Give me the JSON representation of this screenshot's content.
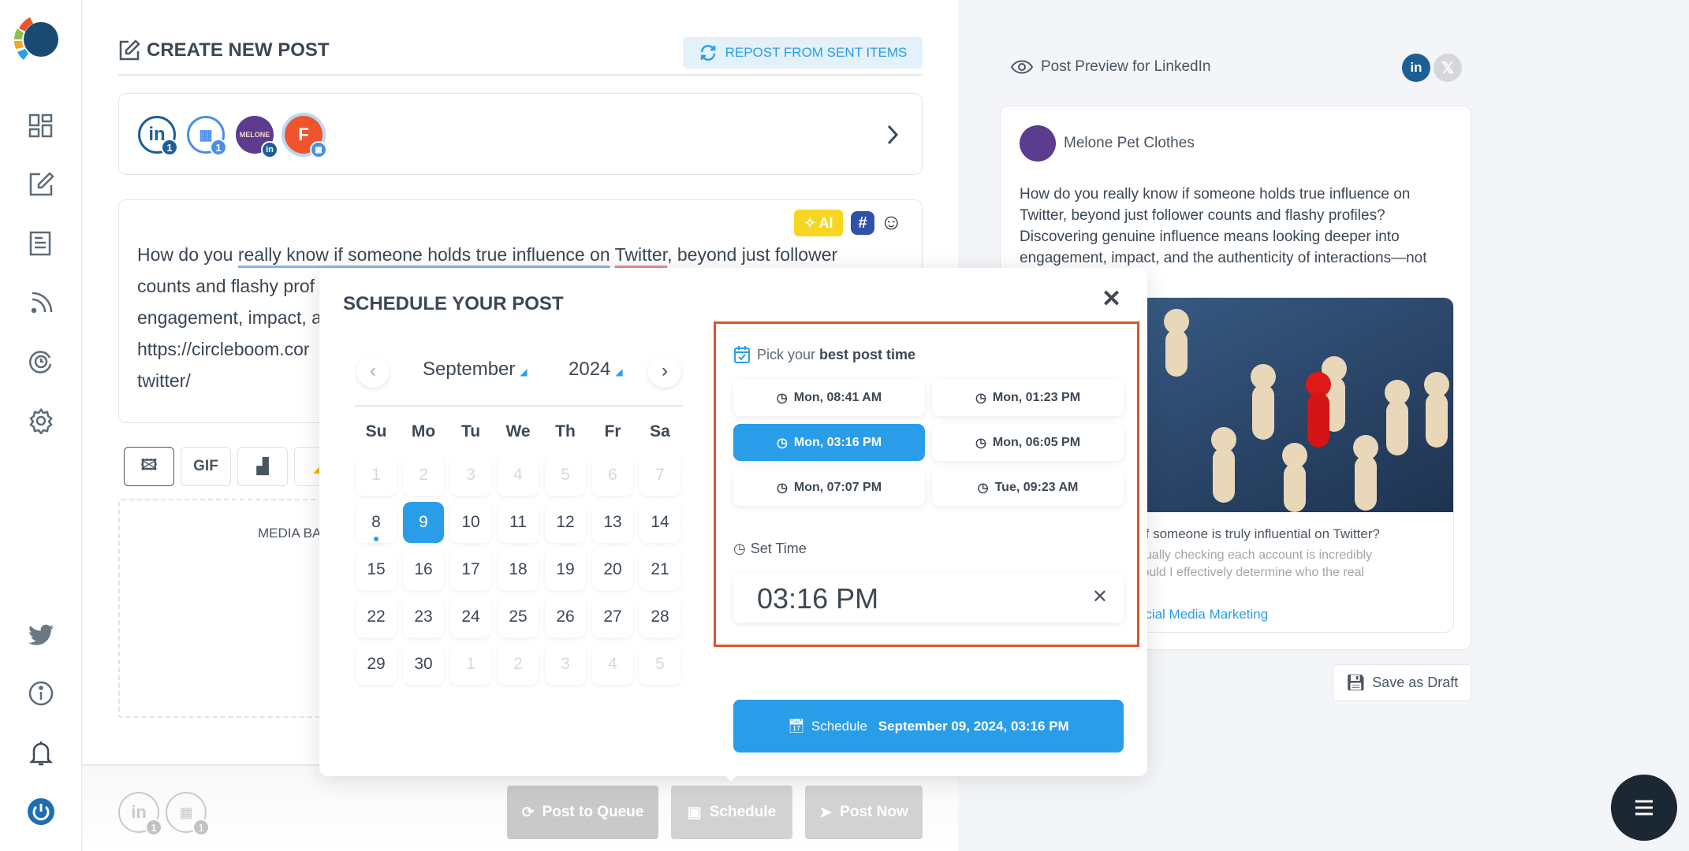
{
  "sidebar": {
    "items": [
      "dashboard",
      "compose",
      "articles",
      "rss",
      "queue",
      "settings",
      "twitter",
      "info",
      "notifications",
      "power"
    ]
  },
  "header": {
    "title": "CREATE NEW POST",
    "repost_label": "REPOST FROM SENT ITEMS"
  },
  "accounts": [
    {
      "type": "linkedin",
      "count": "1"
    },
    {
      "type": "google-business",
      "count": "1"
    },
    {
      "type": "melone-linkedin",
      "label": "MELONE"
    },
    {
      "type": "facebook",
      "label": "F"
    }
  ],
  "composer": {
    "ai_label": "AI",
    "text_a": "How do you ",
    "text_u1": "really know if someone holds true influence on",
    "text_b": " ",
    "text_u2": "Twitter",
    "text_c": ", beyond just follower",
    "line2": "counts and flashy prof",
    "line3": "engagement, impact, a",
    "line4": "https://circleboom.cor",
    "line5": "twitter/"
  },
  "media": {
    "gif_label": "GIF",
    "dropzone_label": "MEDIA BA"
  },
  "footer": {
    "post_queue": "Post to Queue",
    "schedule": "Schedule",
    "post_now": "Post Now",
    "accounts": [
      {
        "type": "linkedin",
        "count": "1"
      },
      {
        "type": "google-business",
        "count": "1"
      }
    ]
  },
  "modal": {
    "title": "SCHEDULE YOUR POST",
    "month": "September",
    "year": "2024",
    "weekdays": [
      "Su",
      "Mo",
      "Tu",
      "We",
      "Th",
      "Fr",
      "Sa"
    ],
    "days": [
      [
        "1",
        "2",
        "3",
        "4",
        "5",
        "6",
        "7"
      ],
      [
        "8",
        "9",
        "10",
        "11",
        "12",
        "13",
        "14"
      ],
      [
        "15",
        "16",
        "17",
        "18",
        "19",
        "20",
        "21"
      ],
      [
        "22",
        "23",
        "24",
        "25",
        "26",
        "27",
        "28"
      ],
      [
        "29",
        "30",
        "1",
        "2",
        "3",
        "4",
        "5"
      ]
    ],
    "selected_day": "9",
    "today_day": "8",
    "best_label_a": "Pick your ",
    "best_label_b": "best post time",
    "times": [
      "Mon, 08:41 AM",
      "Mon, 01:23 PM",
      "Mon, 03:16 PM",
      "Mon, 06:05 PM",
      "Mon, 07:07 PM",
      "Tue, 09:23 AM"
    ],
    "selected_time": "Mon, 03:16 PM",
    "set_time_label": "Set Time",
    "time_value": "03:16 PM",
    "schedule_label": "Schedule",
    "schedule_value": "September 09, 2024, 03:16 PM"
  },
  "preview": {
    "title": "Post Preview for LinkedIn",
    "account": "Melone Pet Clothes",
    "text": "How do you really know if someone holds true influence on Twitter, beyond just follower counts and flashy profiles? Discovering genuine influence means looking deeper into engagement, impact, and the authenticity of interactions—not just numbers.",
    "link_title": "nine if someone is truly influential on Twitter?",
    "link_desc1": "t manually checking each account is incredibly",
    "link_desc2": "low could I effectively determine who the real",
    "link_source": "| - Social Media Marketing",
    "save_draft": "Save as Draft"
  },
  "colors": {
    "accent": "#2a9de8",
    "highlight_box": "#d9562b",
    "linkedin": "#1d5e95",
    "menu_button": "#1b2733"
  }
}
